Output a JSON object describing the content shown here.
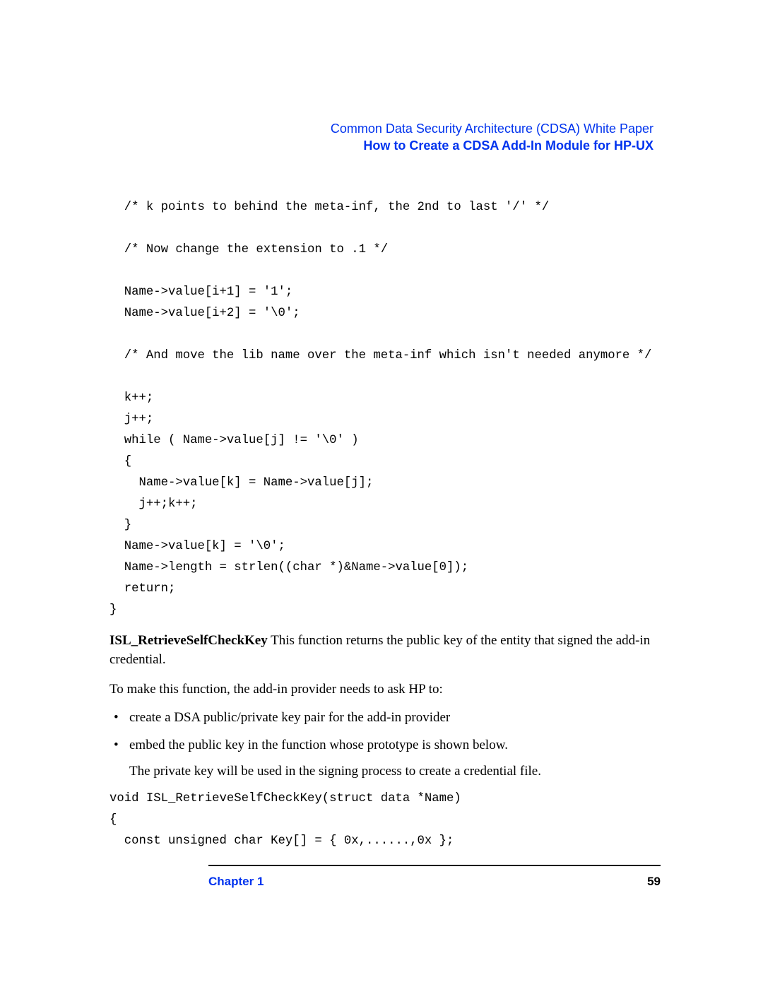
{
  "header": {
    "line1": "Common Data Security Architecture (CDSA) White Paper",
    "line2": "How to Create a CDSA Add-In Module for HP-UX"
  },
  "code1": "  /* k points to behind the meta-inf, the 2nd to last '/' */\n\n  /* Now change the extension to .1 */\n\n  Name->value[i+1] = '1';\n  Name->value[i+2] = '\\0';\n\n  /* And move the lib name over the meta-inf which isn't needed anymore */\n\n  k++;\n  j++;\n  while ( Name->value[j] != '\\0' )\n  {\n    Name->value[k] = Name->value[j];\n    j++;k++;\n  }\n  Name->value[k] = '\\0';\n  Name->length = strlen((char *)&Name->value[0]);\n  return;\n}",
  "section": {
    "funcName": "ISL_RetrieveSelfCheckKey",
    "funcDesc": "  This function returns the public key of the entity that signed the add-in credential.",
    "lead": "To make this function, the add-in provider needs to ask HP to:",
    "bullets": [
      "create a DSA public/private key pair for the add-in provider",
      "embed the public key in the function whose prototype is shown below."
    ],
    "subnote": "The private key will be used in the signing process to create a credential file."
  },
  "code2": "void ISL_RetrieveSelfCheckKey(struct data *Name)\n{\n  const unsigned char Key[] = { 0x,......,0x };",
  "footer": {
    "chapter": "Chapter 1",
    "page": "59"
  }
}
